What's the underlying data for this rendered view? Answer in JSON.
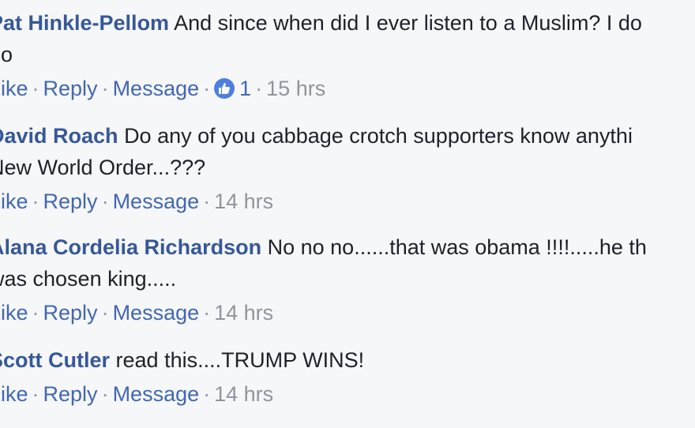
{
  "comments": [
    {
      "author": "Pat Hinkle-Pellom",
      "text_line1": "And since when did I ever listen to a Muslim? I do",
      "text_line2": "no",
      "actions": {
        "like": "Like",
        "reply": "Reply",
        "message": "Message"
      },
      "likes": "1",
      "time": "15 hrs"
    },
    {
      "author": "David Roach",
      "text_line1": "Do any of you cabbage crotch supporters know anythi",
      "text_line2": "New World Order...???",
      "actions": {
        "like": "Like",
        "reply": "Reply",
        "message": "Message"
      },
      "time": "14 hrs"
    },
    {
      "author": "Alana Cordelia Richardson",
      "text_line1": "No no no......that was obama !!!!.....he th",
      "text_line2": "was chosen king.....",
      "actions": {
        "like": "Like",
        "reply": "Reply",
        "message": "Message"
      },
      "time": "14 hrs"
    },
    {
      "author": "Scott Cutler",
      "text_line1": "read this....TRUMP WINS!",
      "actions": {
        "like": "Like",
        "reply": "Reply",
        "message": "Message"
      },
      "time": "14 hrs"
    }
  ],
  "separator": "·",
  "colors": {
    "author": "#365899",
    "link": "#4267b2",
    "meta": "#90949c",
    "text": "#1d2129",
    "background": "#f6f7f9"
  },
  "icons": {
    "like_reaction": "thumbs-up-icon"
  }
}
